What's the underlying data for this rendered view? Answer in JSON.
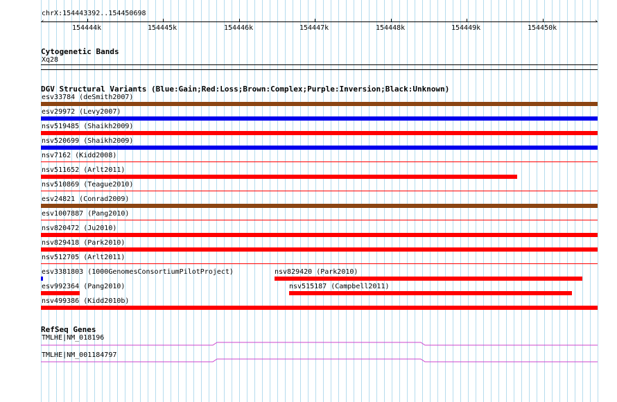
{
  "ruler": {
    "coords": "chrX:154443392..154450698",
    "ticks": [
      "154444k",
      "154445k",
      "154446k",
      "154447k",
      "154448k",
      "154449k",
      "154450k"
    ]
  },
  "cytoband": {
    "title": "Cytogenetic Bands",
    "band": "Xq28"
  },
  "dgv": {
    "title": "DGV Structural Variants (Blue:Gain;Red:Loss;Brown:Complex;Purple:Inversion;Black:Unknown)",
    "labels": [
      "esv33784 (deSmith2007)",
      "esv29972 (Levy2007)",
      "nsv519485 (Shaikh2009)",
      "nsv520699 (Shaikh2009)",
      "nsv7162 (Kidd2008)",
      "nsv511652 (Arlt2011)",
      "nsv510869 (Teague2010)",
      "esv24821 (Conrad2009)",
      "esv1007887 (Pang2010)",
      "nsv820472 (Ju2010)",
      "nsv829418 (Park2010)",
      "nsv512705 (Arlt2011)",
      "esv3381803 (1000GenomesConsortiumPilotProject)",
      "nsv829420 (Park2010)",
      "esv992364 (Pang2010)",
      "nsv515187 (Campbell2011)",
      "nsv499386 (Kidd2010b)"
    ],
    "colors": {
      "gain": "#0000ee",
      "loss": "#ff0000",
      "complex": "#8b4513"
    }
  },
  "refseq": {
    "title": "RefSeq Genes",
    "genes": [
      "TMLHE|NM_018196",
      "TMLHE|NM_001184797"
    ],
    "color": "#cc44cc"
  }
}
